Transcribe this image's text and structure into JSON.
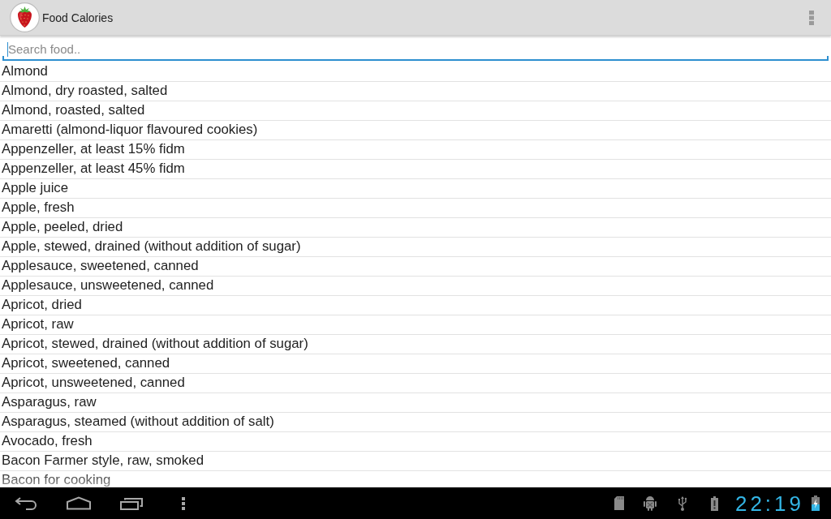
{
  "action_bar": {
    "title": "Food Calories"
  },
  "search": {
    "placeholder": "Search food..",
    "focused": true
  },
  "foods": [
    "Almond",
    "Almond, dry roasted, salted",
    "Almond, roasted, salted",
    "Amaretti (almond-liquor flavoured cookies)",
    "Appenzeller, at least 15% fidm",
    "Appenzeller, at least 45% fidm",
    "Apple juice",
    "Apple, fresh",
    "Apple, peeled, dried",
    "Apple, stewed, drained (without addition of sugar)",
    "Applesauce, sweetened, canned",
    "Applesauce, unsweetened, canned",
    "Apricot, dried",
    "Apricot, raw",
    "Apricot, stewed, drained (without addition of sugar)",
    "Apricot, sweetened, canned",
    "Apricot, unsweetened, canned",
    "Asparagus, raw",
    "Asparagus, steamed (without addition of salt)",
    "Avocado, fresh",
    "Bacon Farmer style, raw, smoked",
    "Bacon for cooking"
  ],
  "nav_bar": {
    "clock": "22:19"
  }
}
